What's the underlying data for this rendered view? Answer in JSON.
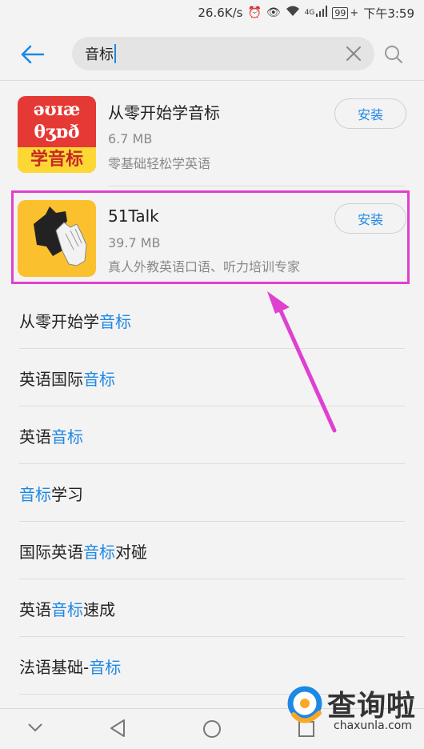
{
  "status_bar": {
    "speed": "26.6K/s",
    "network": "4G",
    "battery": "99",
    "time": "下午3:59"
  },
  "search": {
    "query": "音标"
  },
  "apps": [
    {
      "name": "从零开始学音标",
      "size": "6.7 MB",
      "description": "零基础轻松学英语",
      "install_label": "安装",
      "icon_lines": [
        "əʊɪæ",
        "θʒɒð",
        "学音标"
      ]
    },
    {
      "name": "51Talk",
      "size": "39.7 MB",
      "description": "真人外教英语口语、听力培训专家",
      "install_label": "安装"
    }
  ],
  "suggestions": [
    {
      "before": "从零开始学",
      "match": "音标",
      "after": ""
    },
    {
      "before": "英语国际",
      "match": "音标",
      "after": ""
    },
    {
      "before": "英语",
      "match": "音标",
      "after": ""
    },
    {
      "before": "",
      "match": "音标",
      "after": "学习"
    },
    {
      "before": "国际英语",
      "match": "音标",
      "after": "对碰"
    },
    {
      "before": "英语",
      "match": "音标",
      "after": "速成"
    },
    {
      "before": "法语基础-",
      "match": "音标",
      "after": ""
    }
  ],
  "watermark": {
    "text": "查询啦",
    "url": "chaxunla.com"
  },
  "colors": {
    "accent": "#1e88e5",
    "highlight_border": "#e040d0",
    "arrow": "#e040d0",
    "icon1_bg": "#e53935",
    "icon1_band": "#fdd835",
    "icon2_bg": "#fbc02d"
  }
}
